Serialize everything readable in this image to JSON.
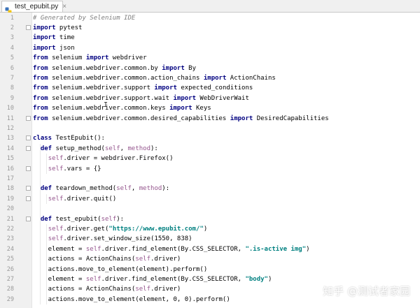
{
  "tab": {
    "title": "test_epubit.py",
    "close": "×"
  },
  "lines": [
    {
      "n": "1",
      "t": "# Generated by Selenium IDE"
    },
    {
      "n": "2",
      "t": "import pytest"
    },
    {
      "n": "3",
      "t": "import time"
    },
    {
      "n": "4",
      "t": "import json"
    },
    {
      "n": "5",
      "t": "from selenium import webdriver"
    },
    {
      "n": "6",
      "t": "from selenium.webdriver.common.by import By"
    },
    {
      "n": "7",
      "t": "from selenium.webdriver.common.action_chains import ActionChains"
    },
    {
      "n": "8",
      "t": "from selenium.webdriver.support import expected_conditions"
    },
    {
      "n": "9",
      "t": "from selenium.webdriver.support.wait import WebDriverWait"
    },
    {
      "n": "10",
      "t": "from selenium.webdriver.common.keys import Keys"
    },
    {
      "n": "11",
      "t": "from selenium.webdriver.common.desired_capabilities import DesiredCapabilities"
    },
    {
      "n": "12",
      "t": ""
    },
    {
      "n": "13",
      "t": "class TestEpubit():"
    },
    {
      "n": "14",
      "t": "  def setup_method(self, method):"
    },
    {
      "n": "15",
      "t": "    self.driver = webdriver.Firefox()"
    },
    {
      "n": "16",
      "t": "    self.vars = {}"
    },
    {
      "n": "17",
      "t": ""
    },
    {
      "n": "18",
      "t": "  def teardown_method(self, method):"
    },
    {
      "n": "19",
      "t": "    self.driver.quit()"
    },
    {
      "n": "20",
      "t": ""
    },
    {
      "n": "21",
      "t": "  def test_epubit(self):"
    },
    {
      "n": "22",
      "t": "    self.driver.get(\"https://www.epubit.com/\")"
    },
    {
      "n": "23",
      "t": "    self.driver.set_window_size(1550, 838)"
    },
    {
      "n": "24",
      "t": "    element = self.driver.find_element(By.CSS_SELECTOR, \".is-active img\")"
    },
    {
      "n": "25",
      "t": "    actions = ActionChains(self.driver)"
    },
    {
      "n": "26",
      "t": "    actions.move_to_element(element).perform()"
    },
    {
      "n": "27",
      "t": "    element = self.driver.find_element(By.CSS_SELECTOR, \"body\")"
    },
    {
      "n": "28",
      "t": "    actions = ActionChains(self.driver)"
    },
    {
      "n": "29",
      "t": "    actions.move_to_element(element, 0, 0).perform()"
    }
  ],
  "cursor_glyph": "I",
  "watermark": "知乎 @测试者家园",
  "colors": {
    "keyword": "#000080",
    "comment": "#808080",
    "self": "#94558d",
    "string": "#008080",
    "gutter": "#f0f0f0"
  }
}
